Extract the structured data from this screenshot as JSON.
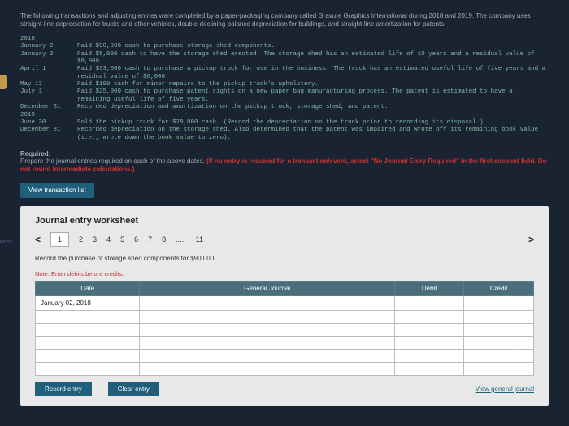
{
  "intro": "The following transactions and adjusting entries were completed by a paper-packaging company called Gravure Graphics International during 2018 and 2019. The company uses straight-line depreciation for trucks and other vehicles, double-declining-balance depreciation for buildings, and straight-line amortization for patents.",
  "trans": {
    "y2018": "2018",
    "y2019": "2019",
    "rows": [
      {
        "date": "January  2",
        "desc": "Paid $90,000 cash to purchase storage shed components."
      },
      {
        "date": "January  3",
        "desc": "Paid $5,000 cash to have the storage shed erected. The storage shed has an estimated life of 10 years and a residual value of $8,000."
      },
      {
        "date": "April  1",
        "desc": "Paid $33,000 cash to purchase a pickup truck for use in the business. The truck has an estimated useful life of five years and a residual value of $6,000."
      },
      {
        "date": "May 13",
        "desc": "Paid $100 cash for minor repairs to the pickup truck's upholstery."
      },
      {
        "date": "July  1",
        "desc": "Paid $25,000 cash to purchase patent rights on a new paper bag manufacturing process. The patent is estimated to have a remaining useful life of five years."
      },
      {
        "date": "December 31",
        "desc": "Recorded depreciation and amortization on the pickup truck, storage shed, and patent."
      }
    ],
    "rows2": [
      {
        "date": "June 30",
        "desc": "Sold the pickup truck for $28,000 cash. (Record the depreciation on the truck prior to recording its disposal.)"
      },
      {
        "date": "December 31",
        "desc": "Recorded depreciation on the storage shed. Also determined that the patent was impaired and wrote off its remaining book value (i.e., wrote down the book value to zero)."
      }
    ]
  },
  "required": {
    "label": "Required:",
    "text1": "Prepare the journal entries required on each of the above dates. ",
    "text2": "(If no entry is required for a transaction/event, select \"No Journal Entry Required\" in the first account field. Do not round intermediate calculations.)"
  },
  "viewBtn": "View transaction list",
  "worksheet": {
    "title": "Journal entry worksheet",
    "tabs": [
      "1",
      "2",
      "3",
      "4",
      "5",
      "6",
      "7",
      "8",
      ".....",
      "11"
    ],
    "instruction": "Record the purchase of storage shed components for $90,000.",
    "note": "Note: Enter debits before credits.",
    "headers": {
      "date": "Date",
      "gj": "General Journal",
      "debit": "Debit",
      "credit": "Credit"
    },
    "firstDate": "January 02, 2018",
    "btns": {
      "record": "Record entry",
      "clear": "Clear entry",
      "view": "View general journal"
    }
  },
  "sideLabel": "nces"
}
